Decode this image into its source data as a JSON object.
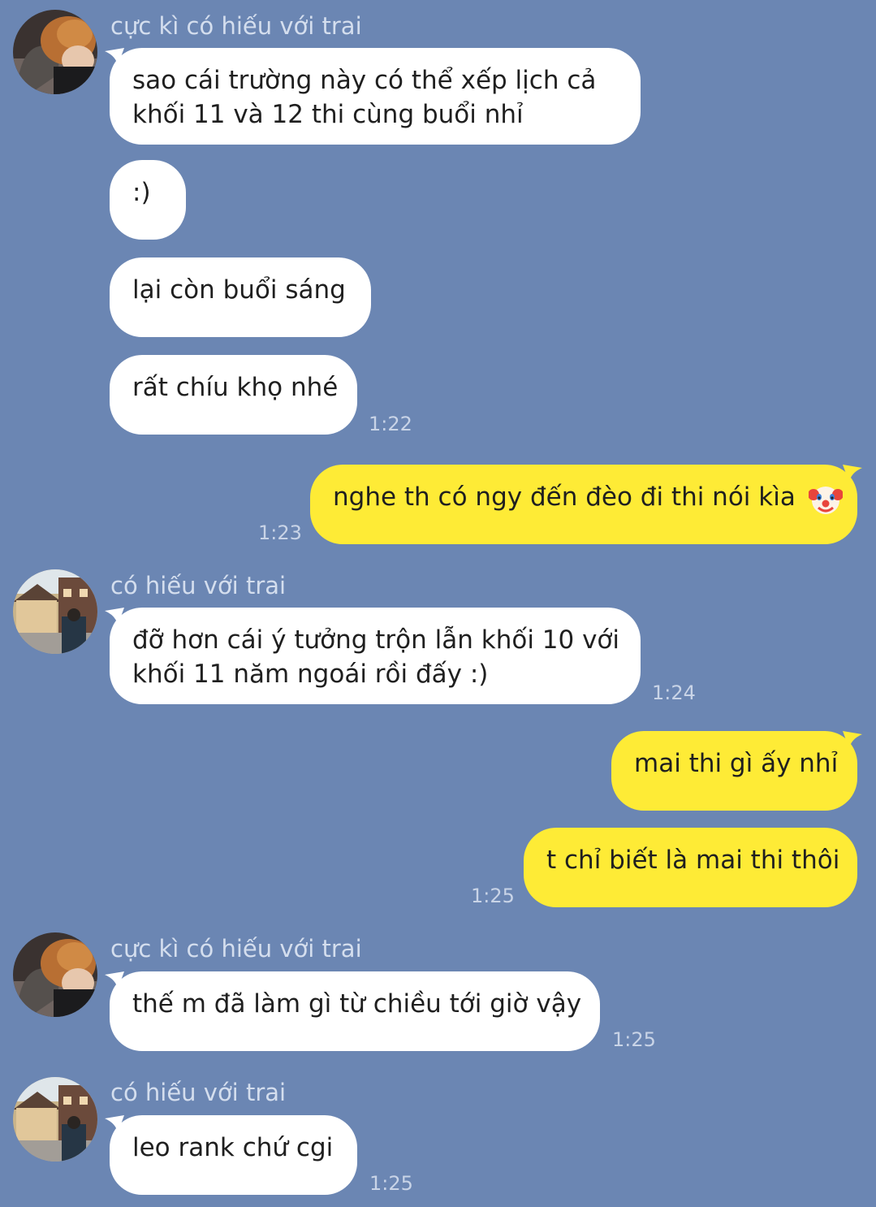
{
  "senders": {
    "a": "cực kì có hiếu với trai",
    "b": "có hiếu với trai"
  },
  "messages": [
    {
      "side": "in",
      "text": "sao cái trường này có thể xếp lịch cả\nkhối 11 và 12 thi cùng buổi nhỉ"
    },
    {
      "side": "in",
      "text": ":)"
    },
    {
      "side": "in",
      "text": "lại còn buổi sáng"
    },
    {
      "side": "in",
      "text": "rất chíu khọ nhé",
      "time": "1:22"
    },
    {
      "side": "out",
      "text": "nghe th có ngy đến đèo đi thi nói kìa",
      "emoji": "clown-face-icon",
      "time": "1:23"
    },
    {
      "side": "in",
      "text": "đỡ hơn cái ý tưởng trộn lẫn khối 10 với\nkhối 11 năm ngoái rồi đấy :)",
      "time": "1:24"
    },
    {
      "side": "out",
      "text": "mai thi gì ấy nhỉ"
    },
    {
      "side": "out",
      "text": "t chỉ biết là mai thi thôi",
      "time": "1:25"
    },
    {
      "side": "in",
      "text": "thế m đã làm gì từ chiều tới giờ vậy",
      "time": "1:25"
    },
    {
      "side": "in",
      "text": "leo rank chứ cgi",
      "time": "1:25"
    }
  ],
  "colors": {
    "background": "#6b86b3",
    "incoming_bubble": "#ffffff",
    "outgoing_bubble": "#feeb36",
    "sender_name": "#d4deee",
    "timestamp": "#c9d4e7"
  },
  "avatars": [
    "avatar-orange-hair-photo",
    "avatar-street-photo"
  ]
}
